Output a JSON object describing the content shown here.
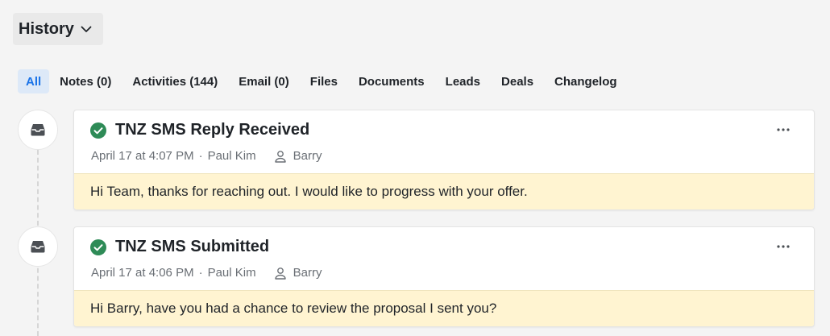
{
  "history_button": {
    "label": "History",
    "icon": "chevron-down-icon"
  },
  "tabs": [
    {
      "label": "All",
      "active": true
    },
    {
      "label": "Notes (0)",
      "active": false
    },
    {
      "label": "Activities (144)",
      "active": false
    },
    {
      "label": "Email (0)",
      "active": false
    },
    {
      "label": "Files",
      "active": false
    },
    {
      "label": "Documents",
      "active": false
    },
    {
      "label": "Leads",
      "active": false
    },
    {
      "label": "Deals",
      "active": false
    },
    {
      "label": "Changelog",
      "active": false
    }
  ],
  "colors": {
    "accent": "#1a73e8",
    "success": "#2e8b57",
    "message_bg": "#fff4d1"
  },
  "entries": [
    {
      "type_icon": "inbox-icon",
      "status_icon": "check-circle-icon",
      "title": "TNZ SMS Reply Received",
      "date": "April 17 at 4:07 PM",
      "author": "Paul Kim",
      "contact": "Barry",
      "message": "Hi Team, thanks for reaching out. I would like to progress with your offer."
    },
    {
      "type_icon": "inbox-icon",
      "status_icon": "check-circle-icon",
      "title": "TNZ SMS Submitted",
      "date": "April 17 at 4:06 PM",
      "author": "Paul Kim",
      "contact": "Barry",
      "message": "Hi Barry, have you had a chance to review the proposal I sent you?"
    }
  ]
}
